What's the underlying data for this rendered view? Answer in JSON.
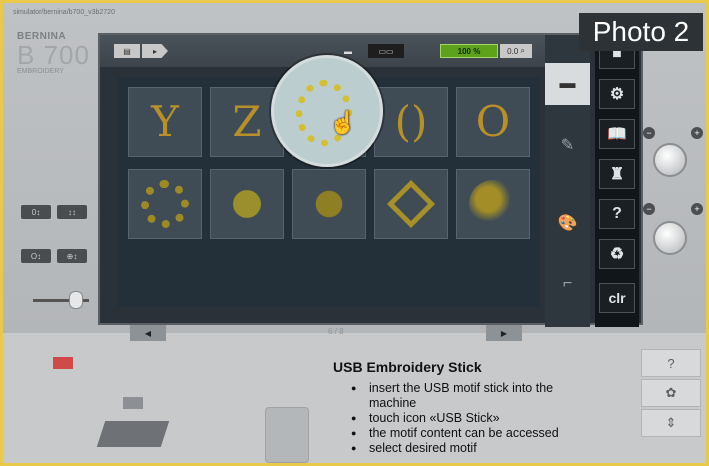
{
  "sim_url": "simulator/bernina/b700_v3b2720",
  "brand": {
    "name": "BERNINA",
    "model": "B 700",
    "line": "EMBROIDERY"
  },
  "photo_label": "Photo 2",
  "toolbar": {
    "zoom": "100 %",
    "zoom_pct": 100,
    "search_label": "0.0"
  },
  "left_buttons": [
    {
      "label": "0↕"
    },
    {
      "label": "↕↕"
    },
    {
      "label": "O↕"
    },
    {
      "label": "⊕↕"
    }
  ],
  "motifs": [
    {
      "icon": "motif-y-icon",
      "glyph": "Y"
    },
    {
      "icon": "motif-z-icon",
      "glyph": "Z"
    },
    {
      "icon": "motif-wreath-c-icon",
      "glyph": ""
    },
    {
      "icon": "motif-parentheses-icon",
      "glyph": "()"
    },
    {
      "icon": "motif-o-icon",
      "glyph": "O"
    },
    {
      "icon": "motif-butterfly-wreath-icon",
      "glyph": ""
    },
    {
      "icon": "motif-bell-icon",
      "glyph": ""
    },
    {
      "icon": "motif-bell-butterfly-icon",
      "glyph": ""
    },
    {
      "icon": "motif-diamond-icon",
      "glyph": ""
    },
    {
      "icon": "motif-leaves-icon",
      "glyph": ""
    }
  ],
  "pager": {
    "text": "6 / 8",
    "prev": "◀",
    "next": "▶"
  },
  "functions": [
    {
      "icon": "home-icon",
      "glyph": "■"
    },
    {
      "icon": "settings-icon",
      "glyph": "⚙"
    },
    {
      "icon": "tutorial-icon",
      "glyph": "📖"
    },
    {
      "icon": "creative-consultant-icon",
      "glyph": "♜"
    },
    {
      "icon": "help-icon",
      "glyph": "?"
    },
    {
      "icon": "eco-icon",
      "glyph": "♻"
    },
    {
      "icon": "clr-button",
      "glyph": "clr"
    }
  ],
  "instruction": {
    "title": "USB Embroidery Stick",
    "items": [
      "insert the USB motif stick into the machine",
      "touch icon «USB Stick»",
      "the motif content can be accessed",
      "select desired motif"
    ]
  },
  "bottom_right": [
    {
      "glyph": "?"
    },
    {
      "glyph": "✿"
    },
    {
      "glyph": "⇕"
    }
  ],
  "colors": {
    "accent_green": "#5ea21b",
    "label_bg": "#2d3236",
    "frame": "#e8c94a"
  }
}
